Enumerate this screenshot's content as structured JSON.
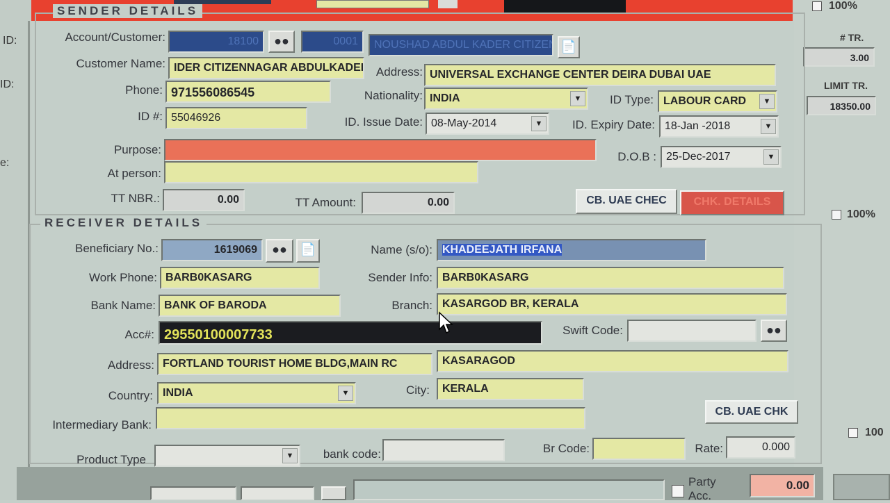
{
  "top": {
    "percent_right": "100%"
  },
  "side_right": {
    "tr_label": "# TR.",
    "tr_value": "3.00",
    "limit_label": "LIMIT TR.",
    "limit_value": "18350.00",
    "percent_mid": "100%",
    "percent_low": "100"
  },
  "side_left": {
    "id1": "ID:",
    "id2": "ID:",
    "e": "e:"
  },
  "sender": {
    "legend": "SENDER DETAILS",
    "account_label": "Account/Customer:",
    "account_no": "18100",
    "account_code": "0001",
    "account_name": "NOUSHAD ABDUL KADER CITIZEN",
    "customer_name_label": "Customer Name:",
    "customer_name": "IDER CITIZENNAGAR ABDULKADER",
    "address_label": "Address:",
    "address": "UNIVERSAL EXCHANGE CENTER DEIRA DUBAI UAE",
    "phone_label": "Phone:",
    "phone": "971556086545",
    "nationality_label": "Nationality:",
    "nationality": "INDIA",
    "idtype_label": "ID Type:",
    "idtype": "LABOUR CARD",
    "idno_label": "ID #:",
    "idno": "55046926",
    "issue_label": "ID. Issue Date:",
    "issue_date": "08-May-2014",
    "expiry_label": "ID. Expiry Date:",
    "expiry_date": "18-Jan -2018",
    "purpose_label": "Purpose:",
    "purpose": "",
    "dob_label": "D.O.B :",
    "dob": "25-Dec-2017",
    "atperson_label": "At person:",
    "atperson": "",
    "ttnbr_label": "TT NBR.:",
    "ttnbr": "0.00",
    "ttamount_label": "TT Amount:",
    "ttamount": "0.00",
    "cb_uae_chec": "CB. UAE CHEC",
    "chk_details": "CHK. DETAILS"
  },
  "receiver": {
    "legend": "RECEIVER DETAILS",
    "benef_label": "Beneficiary No.:",
    "benef_no": "1619069",
    "name_label": "Name (s/o):",
    "name": "KHADEEJATH IRFANA",
    "workphone_label": "Work Phone:",
    "workphone": "BARB0KASARG",
    "senderinfo_label": "Sender Info:",
    "senderinfo": "BARB0KASARG",
    "bank_label": "Bank Name:",
    "bank": "BANK OF BARODA",
    "branch_label": "Branch:",
    "branch": "KASARGOD BR, KERALA",
    "acc_label": "Acc#:",
    "acc": "29550100007733",
    "swift_label": "Swift Code:",
    "swift": "",
    "address_label": "Address:",
    "address1": "FORTLAND TOURIST HOME BLDG,MAIN RC",
    "address2": "KASARAGOD",
    "country_label": "Country:",
    "country": "INDIA",
    "city_label": "City:",
    "city": "KERALA",
    "cb_uae_chk": "CB. UAE CHK",
    "intermediary_label": "Intermediary Bank:",
    "intermediary": "",
    "product_label": "Product Type",
    "product": "",
    "bankcode_label": "bank code:",
    "bankcode": "",
    "brcode_label": "Br Code:",
    "brcode": "",
    "rate_label": "Rate:",
    "rate": "0.000"
  },
  "bottom": {
    "party_label": "Party Acc.",
    "party_value": "0.00"
  }
}
